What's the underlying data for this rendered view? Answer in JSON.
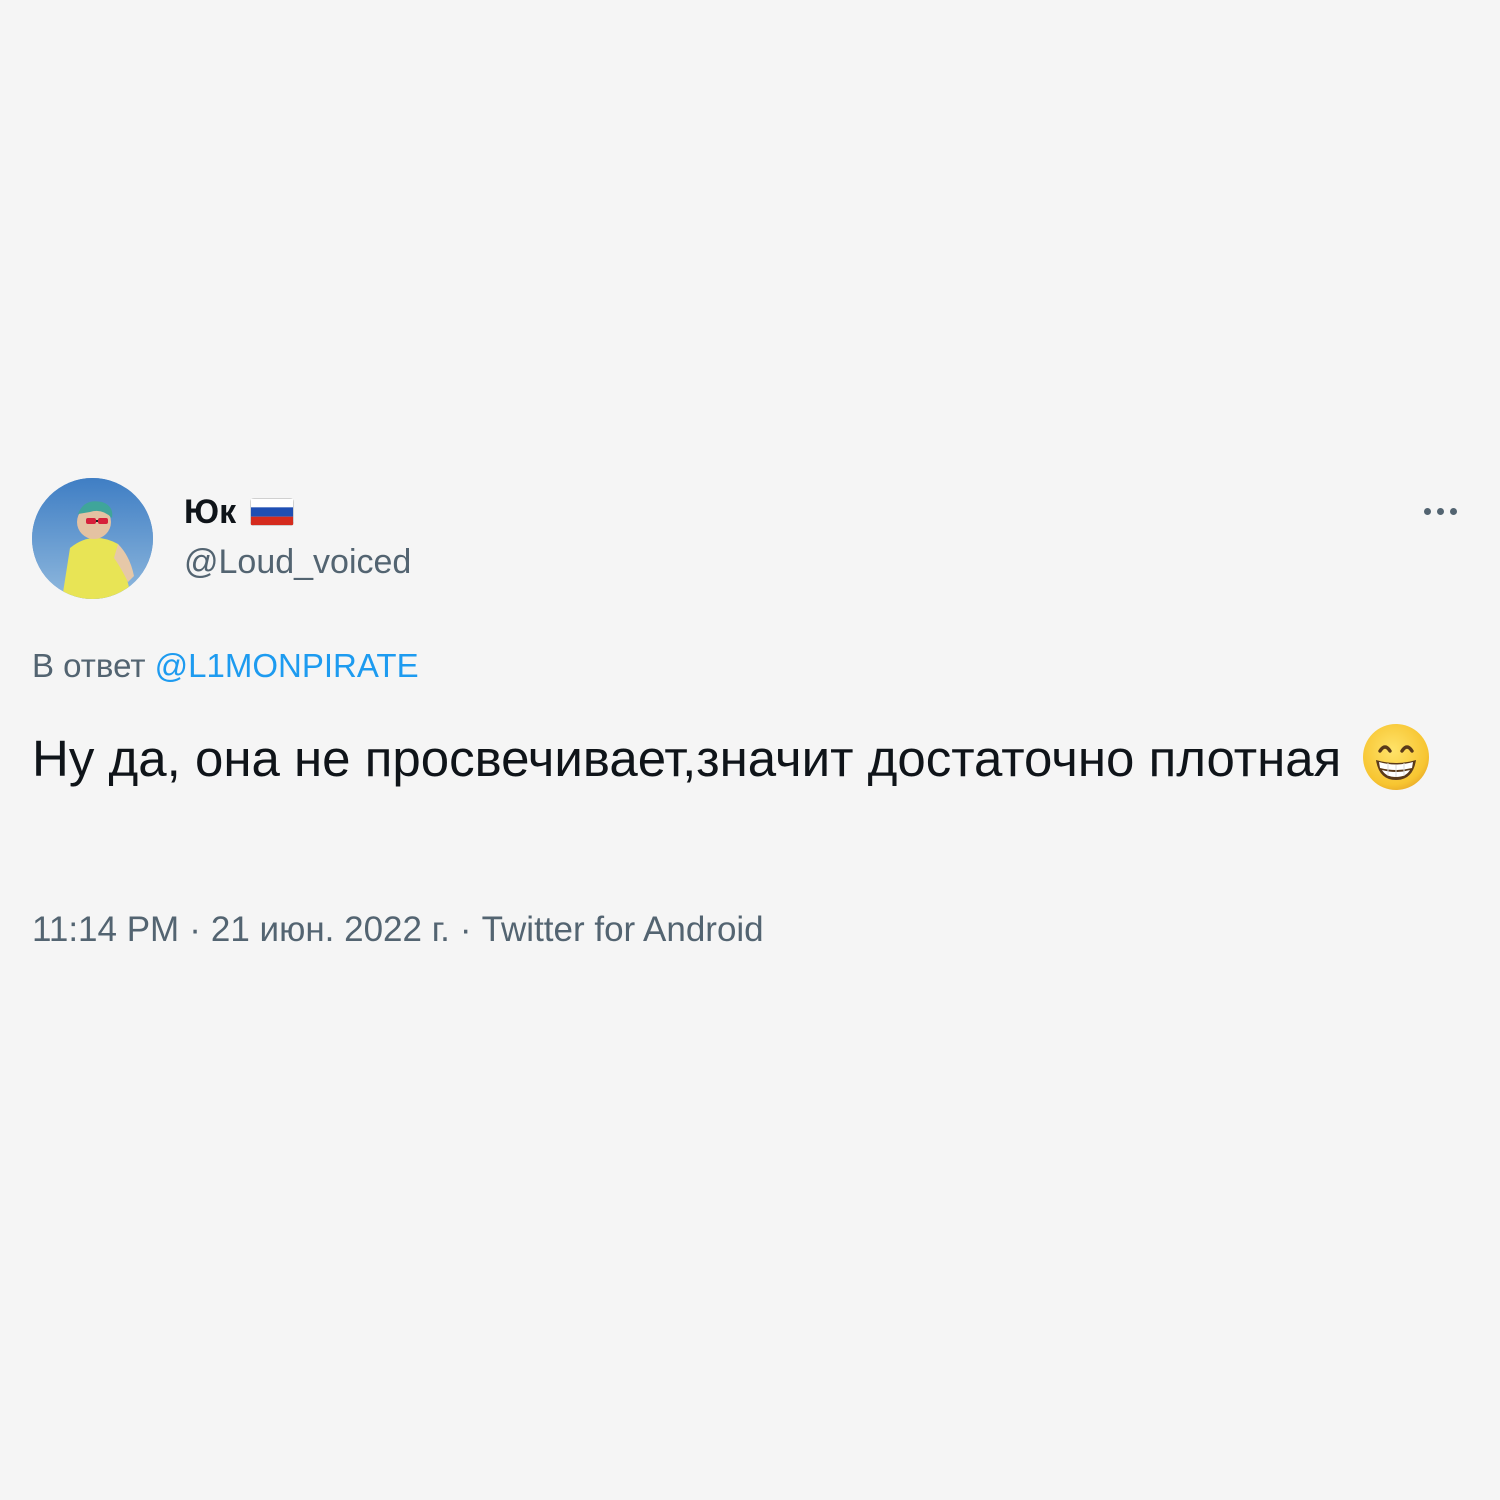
{
  "author": {
    "display_name": "Юк",
    "handle": "@Loud_voiced",
    "flag_icon": "russia-flag-icon",
    "avatar_icon": "profile-avatar"
  },
  "more_icon": "more-horizontal-icon",
  "reply": {
    "prefix": "В ответ",
    "mention": "@L1MONPIRATE"
  },
  "tweet": {
    "text": "Ну да, она не просвечивает,значит достаточно плотная",
    "emoji_icon": "grinning-face-with-smiling-eyes-icon"
  },
  "meta": {
    "time": "11:14 PM",
    "separator": "·",
    "date": "21 июн. 2022 г.",
    "source": "Twitter for Android"
  },
  "colors": {
    "background": "#f5f5f5",
    "text": "#0f1419",
    "secondary": "#536471",
    "accent": "#1d9bf0"
  }
}
